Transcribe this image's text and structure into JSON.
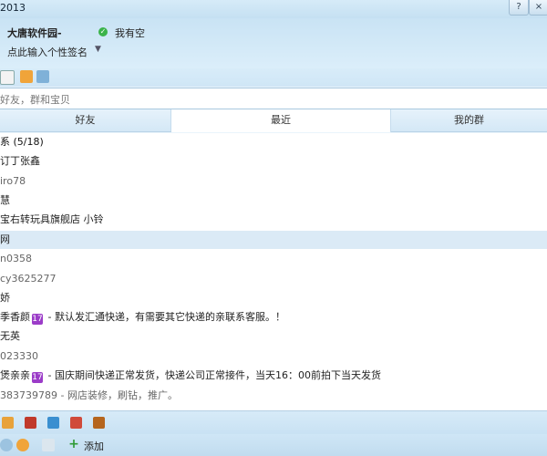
{
  "window": {
    "title": "2013",
    "help_glyph": "?",
    "close_glyph": "×"
  },
  "profile": {
    "nickname": "大唐软件园-",
    "status_text": "我有空",
    "signature": "点此输入个性签名"
  },
  "search": {
    "placeholder": "好友，群和宝贝"
  },
  "tabs": [
    {
      "label": "好友"
    },
    {
      "label": "最近"
    },
    {
      "label": "我的群"
    }
  ],
  "list": [
    {
      "text": "系 (5/18)"
    },
    {
      "text": "订丁张鑫"
    },
    {
      "text": "iro78"
    },
    {
      "text": "慧"
    },
    {
      "text": "宝右转玩具旗舰店 小铃"
    },
    {
      "text": "网"
    },
    {
      "text": "n0358"
    },
    {
      "text": "cy3625277"
    },
    {
      "text": "娇"
    },
    {
      "pre": "季香颜",
      "badge": "17",
      "post": " - 默认发汇通快递，有需要其它快递的亲联系客服。！"
    },
    {
      "text": "无英"
    },
    {
      "text": "023330"
    },
    {
      "pre": "煲亲亲",
      "badge": "17",
      "post": " - 国庆期间快递正常发货，快递公司正常接件，当天16：00前拍下当天发货"
    },
    {
      "text": "383739789 - 网店装修，刷钻，推广。"
    }
  ],
  "footer": {
    "add_label": "添加"
  },
  "colors": {
    "accent": "#3bb34a",
    "badge": "#9b3cc8",
    "selected_row": "#dbeaf6"
  }
}
